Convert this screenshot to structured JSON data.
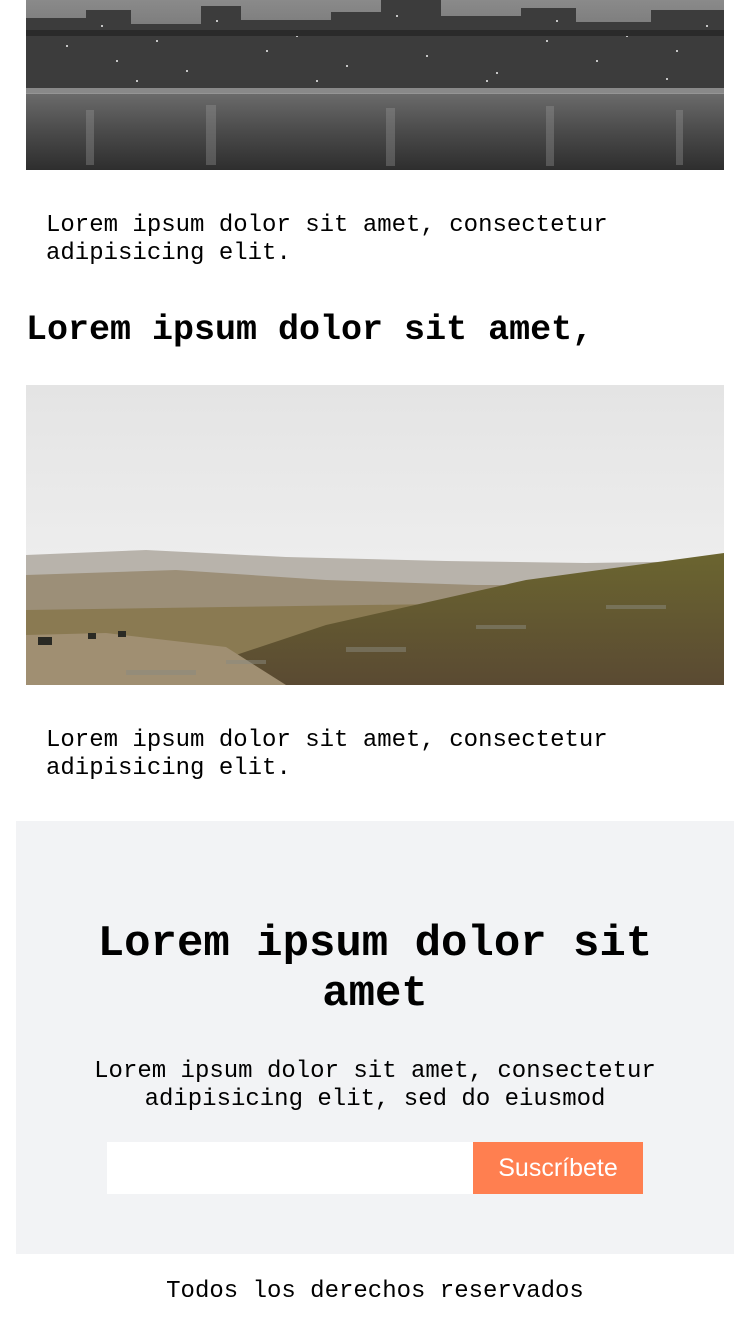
{
  "article_1": {
    "image_icon": "city-skyline-night-image",
    "caption": "Lorem ipsum dolor sit amet, consectetur adipisicing elit."
  },
  "article_2": {
    "heading": "Lorem ipsum dolor sit amet,",
    "image_icon": "hills-landscape-image",
    "caption": "Lorem ipsum dolor sit amet, consectetur adipisicing elit."
  },
  "newsletter": {
    "title": "Lorem ipsum dolor sit amet",
    "text": "Lorem ipsum dolor sit amet, consectetur adipisicing elit, sed do eiusmod",
    "email_value": "",
    "email_placeholder": "",
    "button_label": "Suscríbete",
    "accent_color": "#ff7f50",
    "background_color": "#f2f3f5"
  },
  "footer": {
    "text": "Todos los derechos reservados"
  }
}
